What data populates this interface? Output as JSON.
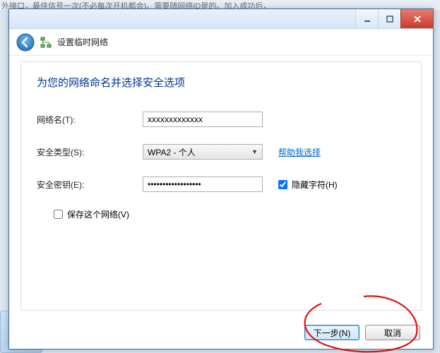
{
  "bg_top_text": "外接口，最佳信号一次(不必每次开机都会)。需要随网络ID是的。加入成功后，",
  "window": {
    "title": "设置临时网络"
  },
  "page_heading": "为您的网络命名并选择安全选项",
  "form": {
    "network_name_label": "网络名(T):",
    "network_name_value": "xxxxxxxxxxxxx",
    "security_type_label": "安全类型(S):",
    "security_type_value": "WPA2 - 个人",
    "help_link": "帮助我选择",
    "security_key_label": "安全密钥(E):",
    "security_key_value": "••••••••••••••••••",
    "hide_chars_checked": true,
    "hide_chars_label": "隐藏字符(H)",
    "save_network_checked": false,
    "save_network_label": "保存这个网络(V)"
  },
  "buttons": {
    "next": "下一步(N)",
    "cancel": "取消"
  }
}
